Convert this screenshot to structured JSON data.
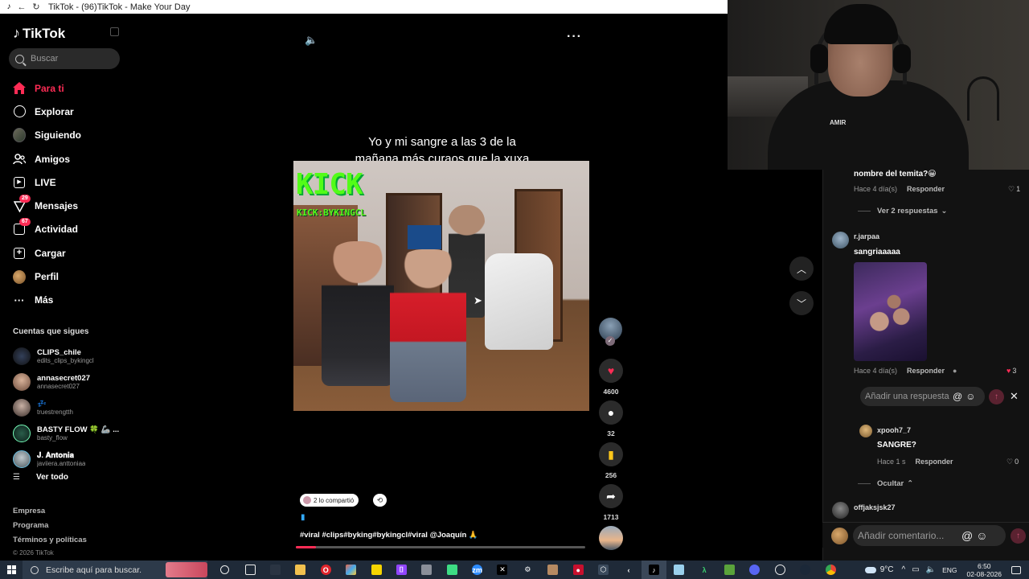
{
  "browser": {
    "title": "TikTok - (96)TikTok - Make Your Day"
  },
  "sidebar": {
    "logo": "TikTok",
    "search_placeholder": "Buscar",
    "nav": [
      {
        "label": "Para ti",
        "icon": "home-icon",
        "active": true
      },
      {
        "label": "Explorar",
        "icon": "compass-icon"
      },
      {
        "label": "Siguiendo",
        "icon": "following-avatar-icon"
      },
      {
        "label": "Amigos",
        "icon": "friends-icon"
      },
      {
        "label": "LIVE",
        "icon": "live-icon"
      },
      {
        "label": "Mensajes",
        "icon": "messages-icon",
        "badge": "29"
      },
      {
        "label": "Actividad",
        "icon": "activity-icon",
        "badge": "67"
      },
      {
        "label": "Cargar",
        "icon": "upload-icon"
      },
      {
        "label": "Perfil",
        "icon": "profile-avatar-icon"
      },
      {
        "label": "Más",
        "icon": "more-icon"
      }
    ],
    "following_title": "Cuentas que sigues",
    "following": [
      {
        "name": "CLIPS_chile",
        "handle": "edits_clips_bykingcl"
      },
      {
        "name": "annasecret027",
        "handle": "annasecret027"
      },
      {
        "name": "💤",
        "handle": "truestrengtth"
      },
      {
        "name": "BASTY FLOW 🍀 🦾 ...",
        "handle": "basty_flow"
      },
      {
        "name": "𝐉. 𝐀𝐧𝐭𝐨𝐧𝐢𝐚",
        "handle": "javiiera.anttoniaa"
      }
    ],
    "see_all": "Ver todo",
    "footer": [
      "Empresa",
      "Programa",
      "Términos y políticas"
    ],
    "copyright": "© 2026 TikTok"
  },
  "video": {
    "caption": "Yo y mi sangre a las 3 de la mañana más curaos que la xuxa",
    "overlay_brand": "KICK",
    "overlay_channel": "KICK:BYKINGCL",
    "shared_label": "2 lo compartió",
    "description": "#viral #clips#byking#bykingcl#viral @Joaquín 🙏",
    "progress": 0.07
  },
  "actions": {
    "likes": "4600",
    "comments": "32",
    "saves": "256",
    "shares": "1713"
  },
  "comments": {
    "items": [
      {
        "text": "nombre del temita?😀",
        "time": "Hace 4 día(s)",
        "reply": "Responder",
        "likes": "1"
      },
      {
        "view_replies": "Ver 2 respuestas"
      },
      {
        "user": "r.jarpaa",
        "text": "sangriaaaaa",
        "time": "Hace 4 día(s)",
        "reply": "Responder",
        "likes": "3"
      },
      {
        "user": "xpooh7_7",
        "text": "SANGRE?",
        "time": "Hace 1 s",
        "reply": "Responder",
        "likes": "0"
      },
      {
        "hide": "Ocultar"
      },
      {
        "user": "offjaksjsk27"
      }
    ],
    "reply_placeholder": "Añadir una respuesta...",
    "comment_placeholder": "Añadir comentario..."
  },
  "webcam": {
    "shirt_logo": "AMIR"
  },
  "taskbar": {
    "search_placeholder": "Escribe aquí para buscar.",
    "weather": "9°C",
    "lang": "ENG",
    "time": "6:50",
    "date": "02-08-2026"
  }
}
